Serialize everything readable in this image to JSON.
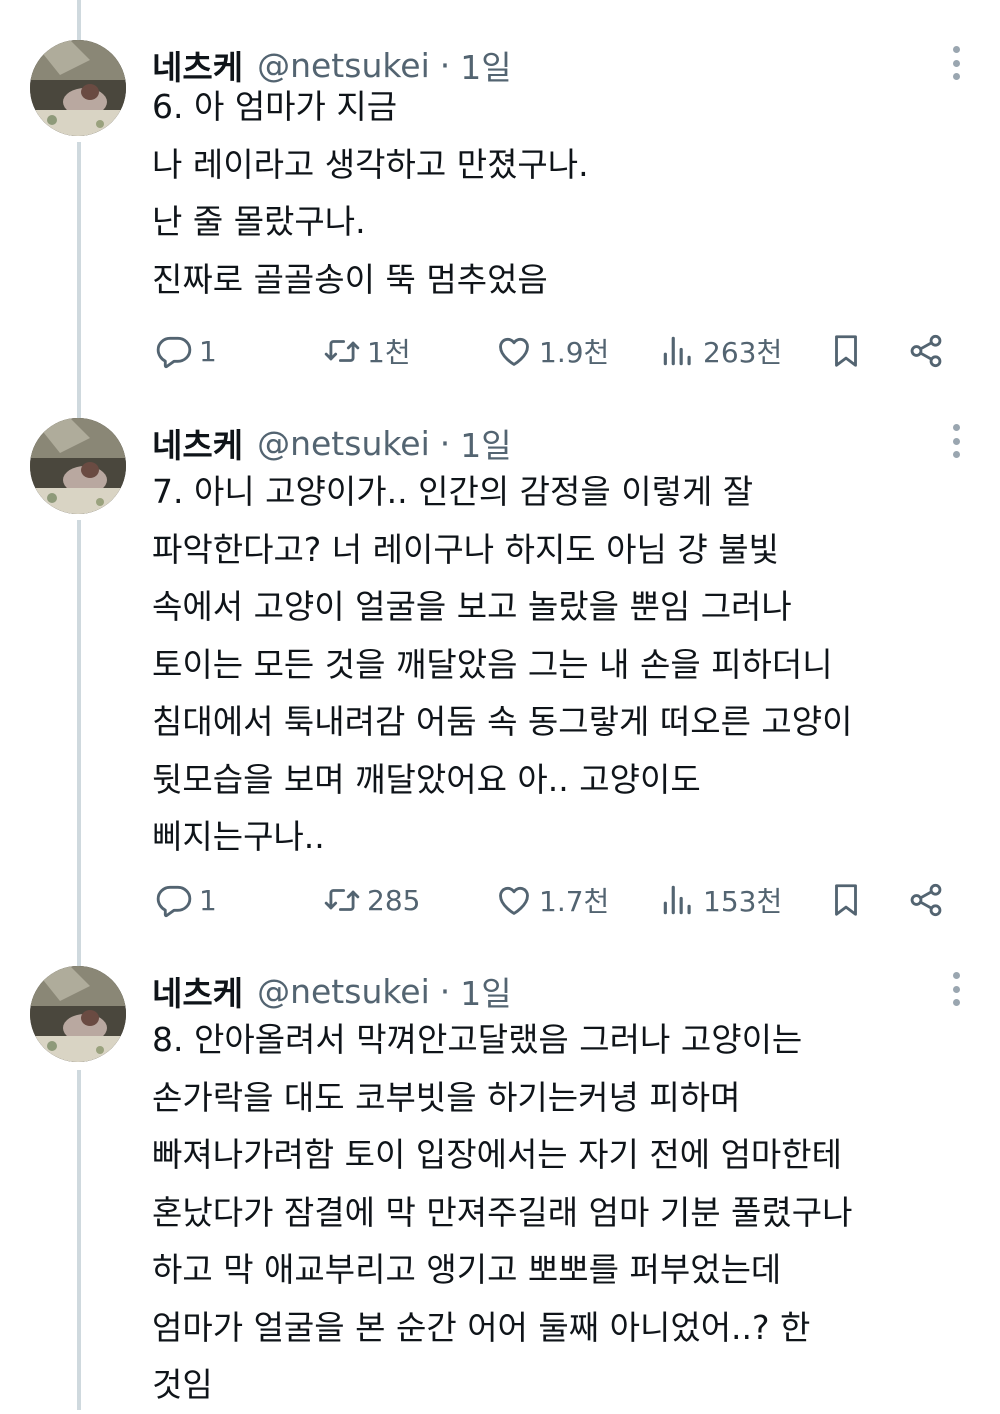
{
  "tweets": [
    {
      "name": "네츠케",
      "handle": "@netsukei",
      "separator": "·",
      "time": "1일",
      "lines": [
        "6. 아 엄마가 지금",
        "나 레이라고 생각하고 만졌구나.",
        "난 줄 몰랐구나.",
        "진짜로 골골송이 뚝 멈추었음"
      ],
      "stats": {
        "replies": "1",
        "retweets": "1천",
        "likes": "1.9천",
        "views": "263천"
      }
    },
    {
      "name": "네츠케",
      "handle": "@netsukei",
      "separator": "·",
      "time": "1일",
      "lines": [
        "7. 아니 고양이가.. 인간의 감정을 이렇게 잘",
        "파악한다고? 너 레이구나 하지도 아님 걍 불빛",
        "속에서 고양이 얼굴을 보고 놀랐을 뿐임 그러나",
        "토이는 모든 것을 깨달았음 그는 내 손을 피하더니",
        "침대에서 툭내려감 어둠 속 동그랗게 떠오른 고양이",
        "뒷모습을 보며 깨달았어요 아.. 고양이도",
        "삐지는구나.."
      ],
      "stats": {
        "replies": "1",
        "retweets": "285",
        "likes": "1.7천",
        "views": "153천"
      }
    },
    {
      "name": "네츠케",
      "handle": "@netsukei",
      "separator": "·",
      "time": "1일",
      "lines": [
        "8. 안아올려서 막껴안고달랬음 그러나 고양이는",
        "손가락을 대도 코부빗을 하기는커녕 피하며",
        "빠져나가려함 토이 입장에서는 자기 전에 엄마한테",
        "혼났다가 잠결에 막 만져주길래 엄마 기분 풀렸구나",
        "하고 막 애교부리고 앵기고 뽀뽀를 퍼부었는데",
        "엄마가 얼굴을 본 순간 어어 둘째 아니었어..? 한",
        "것임"
      ]
    }
  ],
  "icons": {
    "reply": "reply-icon",
    "retweet": "retweet-icon",
    "like": "heart-icon",
    "views": "views-icon",
    "bookmark": "bookmark-icon",
    "share": "share-icon",
    "more": "more-icon"
  },
  "colors": {
    "text": "#0f1419",
    "secondary": "#536471",
    "thread_line": "#cfd9de"
  }
}
